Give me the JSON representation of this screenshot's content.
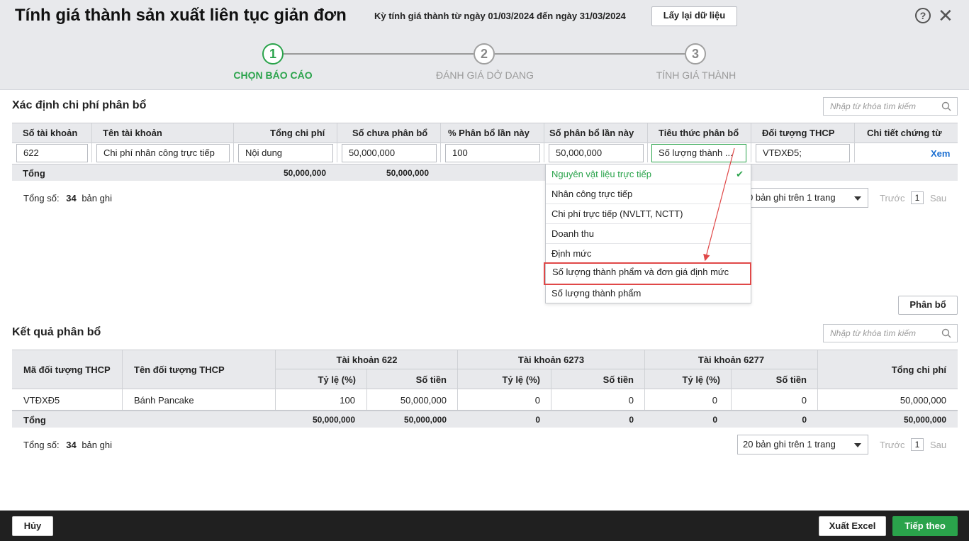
{
  "header": {
    "title": "Tính giá thành sản xuất liên tục giản đơn",
    "period": "Kỳ tính giá thành từ ngày 01/03/2024 đến ngày 31/03/2024",
    "reload_label": "Lấy lại dữ liệu",
    "help_icon": "?",
    "close_icon": "✕"
  },
  "steps": [
    {
      "number": "1",
      "label": "CHỌN BÁO CÁO",
      "active": true
    },
    {
      "number": "2",
      "label": "ĐÁNH GIÁ DỞ DANG",
      "active": false
    },
    {
      "number": "3",
      "label": "TÍNH GIÁ THÀNH",
      "active": false
    }
  ],
  "allocation": {
    "title": "Xác định chi phí phân bổ",
    "search_placeholder": "Nhập từ khóa tìm kiếm",
    "columns": [
      "Số tài khoản",
      "Tên tài khoản",
      "Tổng chi phí",
      "Số chưa phân bổ",
      "% Phân bổ lần này",
      "Số phân bổ lần này",
      "Tiêu thức phân bổ",
      "Đối tượng THCP",
      "Chi tiết chứng từ"
    ],
    "row": {
      "account_no": "622",
      "account_name": "Chi phí nhân công trực tiếp",
      "total_cost": "Nội dung",
      "unallocated": "50,000,000",
      "percent": "100",
      "allocated": "50,000,000",
      "criteria": "Số lượng thành ...",
      "object": "VTĐXĐ5;",
      "detail_link": "Xem"
    },
    "total": {
      "label": "Tổng",
      "total_cost": "50,000,000",
      "unallocated": "50,000,000"
    },
    "record_count_label": "Tổng số:",
    "record_count": "34",
    "record_suffix": "bản ghi",
    "page_size": "0 bản ghi trên 1 trang",
    "prev": "Trước",
    "page": "1",
    "next": "Sau",
    "allocate_button": "Phân bổ"
  },
  "criteria_dropdown": {
    "options": [
      "Nguyên vật liệu trực tiếp",
      "Nhân công trực tiếp",
      "Chi phí trực tiếp (NVLTT, NCTT)",
      "Doanh thu",
      "Định mức",
      "Số lượng thành phẩm và đơn giá định mức",
      "Số lượng thành phẩm"
    ],
    "selected_index": 0,
    "highlighted_index": 5,
    "check_icon": "✔"
  },
  "result": {
    "title": "Kết quả phân bổ",
    "search_placeholder": "Nhập từ khóa tìm kiếm",
    "col_code": "Mã đối tượng THCP",
    "col_name": "Tên đối tượng THCP",
    "groups": [
      "Tài khoản 622",
      "Tài khoản 6273",
      "Tài khoản 6277"
    ],
    "sub_rate": "Tỷ lệ (%)",
    "sub_amount": "Số tiền",
    "col_total": "Tổng chi phí",
    "row": {
      "code": "VTĐXĐ5",
      "name": "Bánh Pancake",
      "rate_622": "100",
      "amount_622": "50,000,000",
      "rate_6273": "0",
      "amount_6273": "0",
      "rate_6277": "0",
      "amount_6277": "0",
      "total": "50,000,000"
    },
    "total": {
      "label": "Tổng",
      "rate_622": "50,000,000",
      "amount_622": "50,000,000",
      "rate_6273": "0",
      "amount_6273": "0",
      "rate_6277": "0",
      "amount_6277": "0",
      "total": "50,000,000"
    },
    "record_count_label": "Tổng số:",
    "record_count": "34",
    "record_suffix": "bản ghi",
    "page_size": "20 bản ghi trên 1 trang",
    "prev": "Trước",
    "page": "1",
    "next": "Sau"
  },
  "footer": {
    "cancel": "Hủy",
    "export": "Xuất Excel",
    "next": "Tiếp theo"
  },
  "colors": {
    "accent": "#2aa34b",
    "highlight": "#e04848",
    "link": "#1b6fd1"
  }
}
